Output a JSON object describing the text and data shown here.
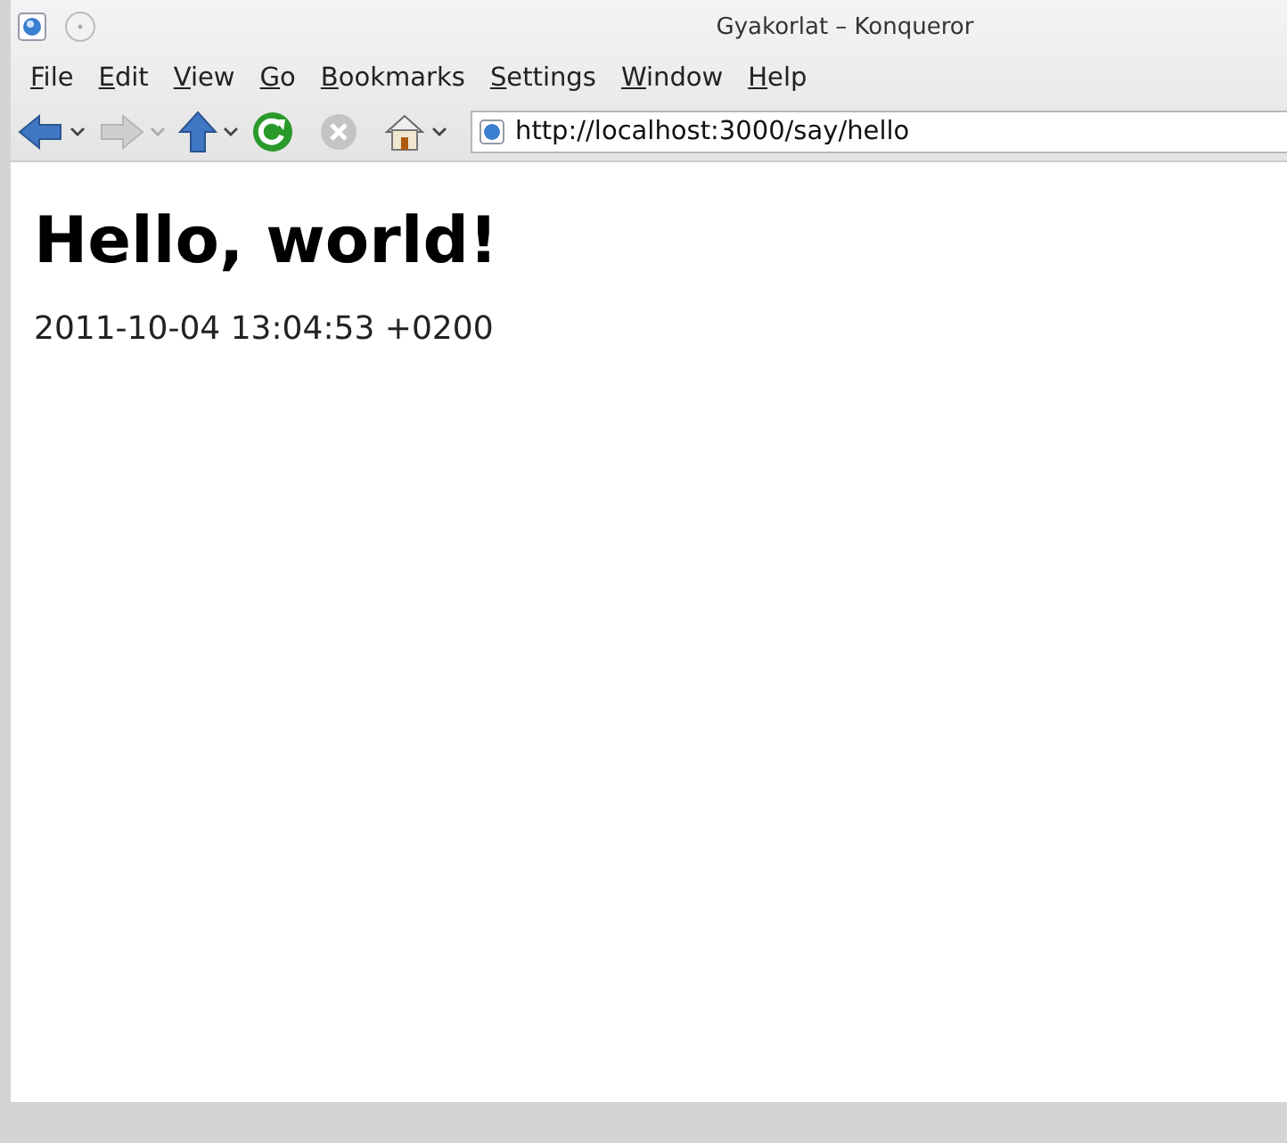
{
  "window": {
    "title": "Gyakorlat – Konqueror"
  },
  "menu": [
    "File",
    "Edit",
    "View",
    "Go",
    "Bookmarks",
    "Settings",
    "Window",
    "Help"
  ],
  "toolbar": {
    "back_enabled": true,
    "forward_enabled": false,
    "stop_enabled": false
  },
  "address_bar": {
    "value": "http://localhost:3000/say/hello"
  },
  "page": {
    "heading": "Hello, world!",
    "timestamp": "2011-10-04 13:04:53 +0200"
  }
}
